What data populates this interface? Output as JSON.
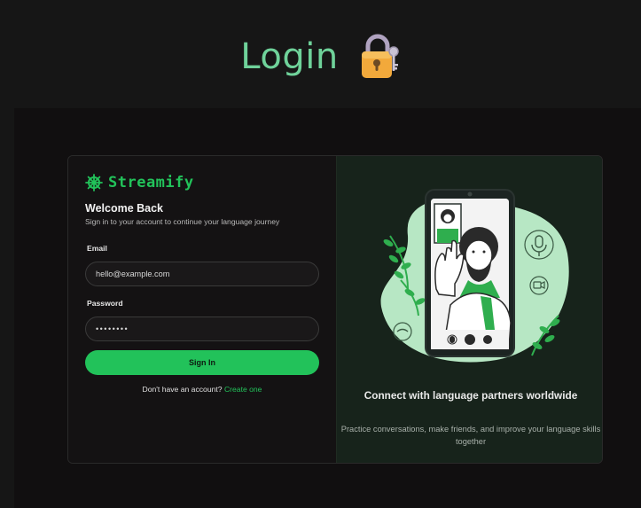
{
  "page": {
    "title": "Login",
    "title_icon": "lock-with-key-icon"
  },
  "brand": {
    "name": "Streamify",
    "icon": "ship-wheel-icon",
    "color": "#22c25a"
  },
  "form": {
    "heading": "Welcome Back",
    "subtitle": "Sign in to your account to continue your language journey",
    "email_label": "Email",
    "email_value": "hello@example.com",
    "password_label": "Password",
    "password_value": "••••••••",
    "submit_label": "Sign In",
    "signup_prompt": "Don't have an account?",
    "signup_link": "Create one"
  },
  "promo": {
    "title": "Connect with language partners worldwide",
    "description": "Practice conversations, make friends, and improve your language skills together",
    "illustration": "video-call-illustration"
  },
  "colors": {
    "background": "#161616",
    "accent": "#22c25a",
    "heading": "#6fd29a",
    "promo_panel": "#17231b"
  }
}
